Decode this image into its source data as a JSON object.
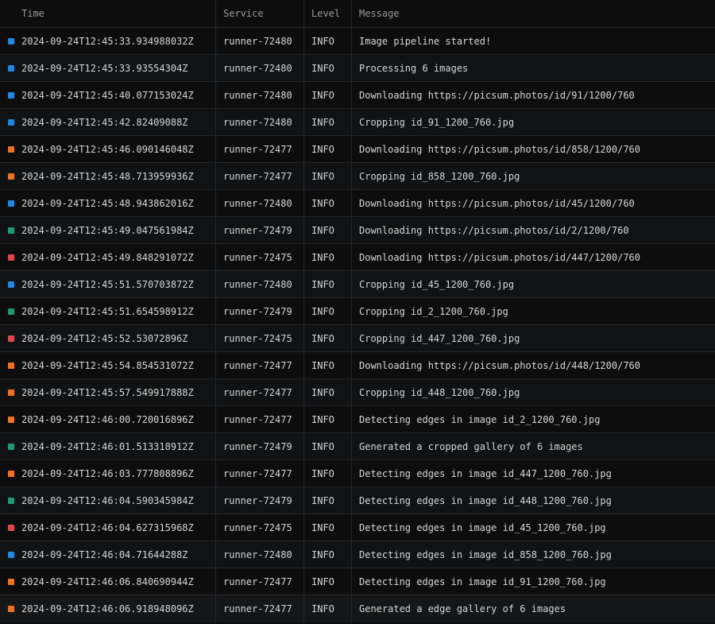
{
  "header": {
    "time": "Time",
    "service": "Service",
    "level": "Level",
    "message": "Message"
  },
  "service_colors": {
    "runner-72480": "#1e88e5",
    "runner-72477": "#f07122",
    "runner-72479": "#1f9a72",
    "runner-72475": "#e0464b"
  },
  "rows": [
    {
      "time": "2024-09-24T12:45:33.934988032Z",
      "service": "runner-72480",
      "level": "INFO",
      "message": "Image pipeline started!"
    },
    {
      "time": "2024-09-24T12:45:33.93554304Z",
      "service": "runner-72480",
      "level": "INFO",
      "message": "Processing 6 images"
    },
    {
      "time": "2024-09-24T12:45:40.077153024Z",
      "service": "runner-72480",
      "level": "INFO",
      "message": "Downloading https://picsum.photos/id/91/1200/760"
    },
    {
      "time": "2024-09-24T12:45:42.82409088Z",
      "service": "runner-72480",
      "level": "INFO",
      "message": "Cropping id_91_1200_760.jpg"
    },
    {
      "time": "2024-09-24T12:45:46.090146048Z",
      "service": "runner-72477",
      "level": "INFO",
      "message": "Downloading https://picsum.photos/id/858/1200/760"
    },
    {
      "time": "2024-09-24T12:45:48.713959936Z",
      "service": "runner-72477",
      "level": "INFO",
      "message": "Cropping id_858_1200_760.jpg"
    },
    {
      "time": "2024-09-24T12:45:48.943862016Z",
      "service": "runner-72480",
      "level": "INFO",
      "message": "Downloading https://picsum.photos/id/45/1200/760"
    },
    {
      "time": "2024-09-24T12:45:49.047561984Z",
      "service": "runner-72479",
      "level": "INFO",
      "message": "Downloading https://picsum.photos/id/2/1200/760"
    },
    {
      "time": "2024-09-24T12:45:49.848291072Z",
      "service": "runner-72475",
      "level": "INFO",
      "message": "Downloading https://picsum.photos/id/447/1200/760"
    },
    {
      "time": "2024-09-24T12:45:51.570703872Z",
      "service": "runner-72480",
      "level": "INFO",
      "message": "Cropping id_45_1200_760.jpg"
    },
    {
      "time": "2024-09-24T12:45:51.654598912Z",
      "service": "runner-72479",
      "level": "INFO",
      "message": "Cropping id_2_1200_760.jpg"
    },
    {
      "time": "2024-09-24T12:45:52.53072896Z",
      "service": "runner-72475",
      "level": "INFO",
      "message": "Cropping id_447_1200_760.jpg"
    },
    {
      "time": "2024-09-24T12:45:54.854531072Z",
      "service": "runner-72477",
      "level": "INFO",
      "message": "Downloading https://picsum.photos/id/448/1200/760"
    },
    {
      "time": "2024-09-24T12:45:57.549917888Z",
      "service": "runner-72477",
      "level": "INFO",
      "message": "Cropping id_448_1200_760.jpg"
    },
    {
      "time": "2024-09-24T12:46:00.720016896Z",
      "service": "runner-72477",
      "level": "INFO",
      "message": "Detecting edges in image id_2_1200_760.jpg"
    },
    {
      "time": "2024-09-24T12:46:01.513318912Z",
      "service": "runner-72479",
      "level": "INFO",
      "message": "Generated a cropped gallery of 6 images"
    },
    {
      "time": "2024-09-24T12:46:03.777808896Z",
      "service": "runner-72477",
      "level": "INFO",
      "message": "Detecting edges in image id_447_1200_760.jpg"
    },
    {
      "time": "2024-09-24T12:46:04.590345984Z",
      "service": "runner-72479",
      "level": "INFO",
      "message": "Detecting edges in image id_448_1200_760.jpg"
    },
    {
      "time": "2024-09-24T12:46:04.627315968Z",
      "service": "runner-72475",
      "level": "INFO",
      "message": "Detecting edges in image id_45_1200_760.jpg"
    },
    {
      "time": "2024-09-24T12:46:04.71644288Z",
      "service": "runner-72480",
      "level": "INFO",
      "message": "Detecting edges in image id_858_1200_760.jpg"
    },
    {
      "time": "2024-09-24T12:46:06.840690944Z",
      "service": "runner-72477",
      "level": "INFO",
      "message": "Detecting edges in image id_91_1200_760.jpg"
    },
    {
      "time": "2024-09-24T12:46:06.918948096Z",
      "service": "runner-72477",
      "level": "INFO",
      "message": "Generated a edge gallery of 6 images"
    }
  ]
}
